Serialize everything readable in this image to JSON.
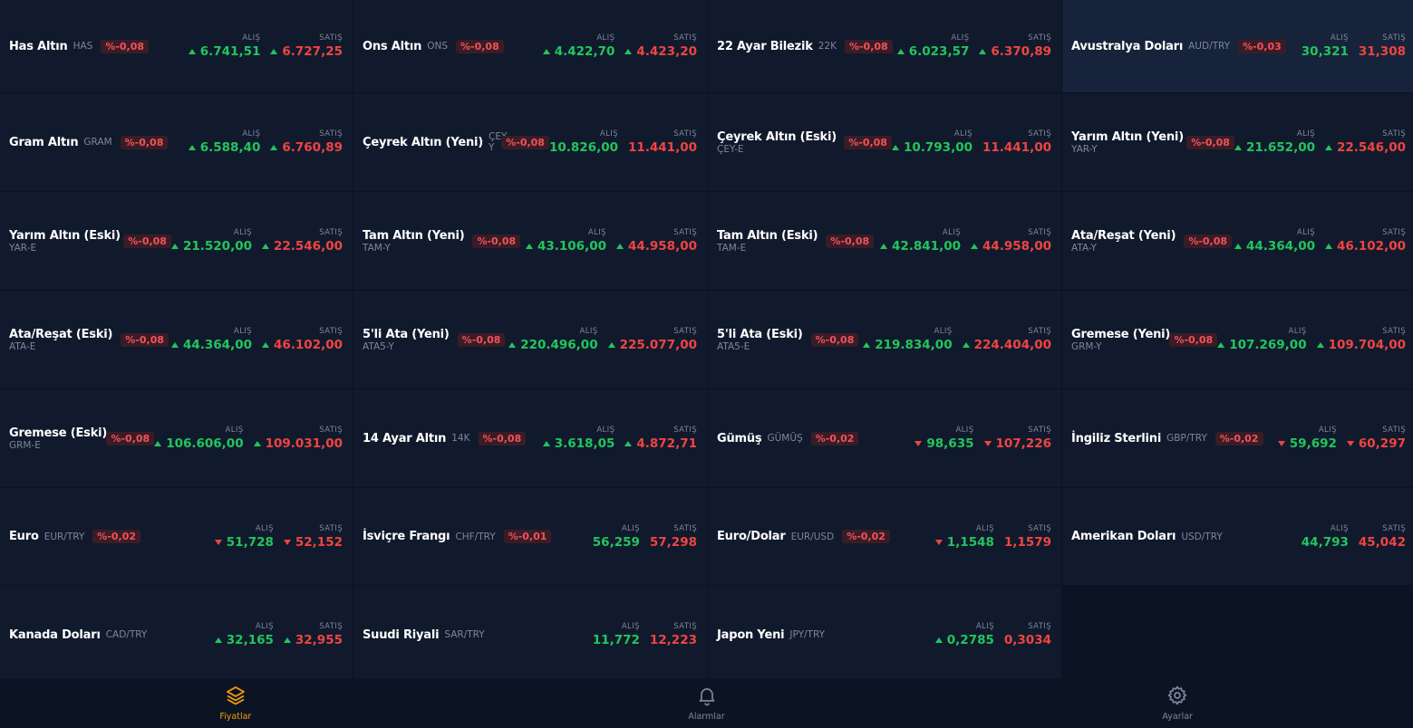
{
  "labels": {
    "buy": "ALIŞ",
    "sell": "SATIŞ"
  },
  "colors": {
    "up": "#22c55e",
    "down": "#ef4444",
    "accent": "#f59e0b",
    "background": "#111a2c"
  },
  "rows": [
    [
      {
        "name": "Has Altın",
        "code": "HAS",
        "badge": "%-0,08",
        "buy": "6.741,51",
        "sell": "6.727,25",
        "buy_arrow": "up",
        "sell_arrow": "up",
        "layout": "inline"
      },
      {
        "name": "Ons Altın",
        "code": "ONS",
        "badge": "%-0,08",
        "buy": "4.422,70",
        "sell": "4.423,20",
        "buy_arrow": "up",
        "sell_arrow": "up",
        "layout": "inline"
      },
      {
        "name": "22 Ayar Bilezik",
        "code": "22K",
        "badge": "%-0,08",
        "buy": "6.023,57",
        "sell": "6.370,89",
        "buy_arrow": "up",
        "sell_arrow": "up",
        "layout": "inline"
      },
      {
        "name": "Avustralya Doları",
        "code": "AUD/TRY",
        "badge": "%-0,03",
        "buy": "30,321",
        "sell": "31,308",
        "buy_arrow": "none",
        "sell_arrow": "none",
        "layout": "inline",
        "highlight": true
      }
    ],
    [
      {
        "name": "Gram Altın",
        "code": "GRAM",
        "badge": "%-0,08",
        "buy": "6.588,40",
        "sell": "6.760,89",
        "buy_arrow": "up",
        "sell_arrow": "up",
        "layout": "inline"
      },
      {
        "name": "Çeyrek Altın (Yeni)",
        "code": "ÇEY-Y",
        "badge": "%-0,08",
        "buy": "10.826,00",
        "sell": "11.441,00",
        "buy_arrow": "none",
        "sell_arrow": "none",
        "layout": "wrap"
      },
      {
        "name": "Çeyrek Altın (Eski)",
        "code": "ÇEY-E",
        "badge": "%-0,08",
        "buy": "10.793,00",
        "sell": "11.441,00",
        "buy_arrow": "up",
        "sell_arrow": "none",
        "layout": "stack"
      },
      {
        "name": "Yarım Altın (Yeni)",
        "code": "YAR-Y",
        "badge": "%-0,08",
        "buy": "21.652,00",
        "sell": "22.546,00",
        "buy_arrow": "up",
        "sell_arrow": "up",
        "layout": "stack"
      }
    ],
    [
      {
        "name": "Yarım Altın (Eski)",
        "code": "YAR-E",
        "badge": "%-0,08",
        "buy": "21.520,00",
        "sell": "22.546,00",
        "buy_arrow": "up",
        "sell_arrow": "up",
        "layout": "stack"
      },
      {
        "name": "Tam Altın (Yeni)",
        "code": "TAM-Y",
        "badge": "%-0,08",
        "buy": "43.106,00",
        "sell": "44.958,00",
        "buy_arrow": "up",
        "sell_arrow": "up",
        "layout": "stack"
      },
      {
        "name": "Tam Altın (Eski)",
        "code": "TAM-E",
        "badge": "%-0,08",
        "buy": "42.841,00",
        "sell": "44.958,00",
        "buy_arrow": "up",
        "sell_arrow": "up",
        "layout": "stack"
      },
      {
        "name": "Ata/Reşat (Yeni)",
        "code": "ATA-Y",
        "badge": "%-0,08",
        "buy": "44.364,00",
        "sell": "46.102,00",
        "buy_arrow": "up",
        "sell_arrow": "up",
        "layout": "stack"
      }
    ],
    [
      {
        "name": "Ata/Reşat (Eski)",
        "code": "ATA-E",
        "badge": "%-0,08",
        "buy": "44.364,00",
        "sell": "46.102,00",
        "buy_arrow": "up",
        "sell_arrow": "up",
        "layout": "stack"
      },
      {
        "name": "5'li Ata (Yeni)",
        "code": "ATA5-Y",
        "badge": "%-0,08",
        "buy": "220.496,00",
        "sell": "225.077,00",
        "buy_arrow": "up",
        "sell_arrow": "up",
        "layout": "stack"
      },
      {
        "name": "5'li Ata (Eski)",
        "code": "ATA5-E",
        "badge": "%-0,08",
        "buy": "219.834,00",
        "sell": "224.404,00",
        "buy_arrow": "up",
        "sell_arrow": "up",
        "layout": "stack"
      },
      {
        "name": "Gremese (Yeni)",
        "code": "GRM-Y",
        "badge": "%-0,08",
        "buy": "107.269,00",
        "sell": "109.704,00",
        "buy_arrow": "up",
        "sell_arrow": "up",
        "layout": "stack"
      }
    ],
    [
      {
        "name": "Gremese (Eski)",
        "code": "GRM-E",
        "badge": "%-0,08",
        "buy": "106.606,00",
        "sell": "109.031,00",
        "buy_arrow": "up",
        "sell_arrow": "up",
        "layout": "stack"
      },
      {
        "name": "14 Ayar Altın",
        "code": "14K",
        "badge": "%-0,08",
        "buy": "3.618,05",
        "sell": "4.872,71",
        "buy_arrow": "up",
        "sell_arrow": "up",
        "layout": "inline"
      },
      {
        "name": "Gümüş",
        "code": "GÜMÜŞ",
        "badge": "%-0,02",
        "buy": "98,635",
        "sell": "107,226",
        "buy_arrow": "down",
        "sell_arrow": "down",
        "layout": "inline"
      },
      {
        "name": "İngiliz Sterlini",
        "code": "GBP/TRY",
        "badge": "%-0,02",
        "buy": "59,692",
        "sell": "60,297",
        "buy_arrow": "down",
        "sell_arrow": "down",
        "layout": "inline"
      }
    ],
    [
      {
        "name": "Euro",
        "code": "EUR/TRY",
        "badge": "%-0,02",
        "buy": "51,728",
        "sell": "52,152",
        "buy_arrow": "down",
        "sell_arrow": "down",
        "layout": "inline"
      },
      {
        "name": "İsviçre Frangı",
        "code": "CHF/TRY",
        "badge": "%-0,01",
        "buy": "56,259",
        "sell": "57,298",
        "buy_arrow": "none",
        "sell_arrow": "none",
        "layout": "inline"
      },
      {
        "name": "Euro/Dolar",
        "code": "EUR/USD",
        "badge": "%-0,02",
        "buy": "1,1548",
        "sell": "1,1579",
        "buy_arrow": "down",
        "sell_arrow": "none",
        "layout": "inline"
      },
      {
        "name": "Amerikan Doları",
        "code": "USD/TRY",
        "badge": "",
        "buy": "44,793",
        "sell": "45,042",
        "buy_arrow": "none",
        "sell_arrow": "none",
        "layout": "inline"
      }
    ],
    [
      {
        "name": "Kanada Doları",
        "code": "CAD/TRY",
        "badge": "",
        "buy": "32,165",
        "sell": "32,955",
        "buy_arrow": "up",
        "sell_arrow": "up",
        "layout": "inline"
      },
      {
        "name": "Suudi Riyali",
        "code": "SAR/TRY",
        "badge": "",
        "buy": "11,772",
        "sell": "12,223",
        "buy_arrow": "none",
        "sell_arrow": "none",
        "layout": "inline"
      },
      {
        "name": "Japon Yeni",
        "code": "JPY/TRY",
        "badge": "",
        "buy": "0,2785",
        "sell": "0,3034",
        "buy_arrow": "up",
        "sell_arrow": "none",
        "layout": "inline"
      },
      null
    ]
  ],
  "nav": [
    {
      "label": "Fiyatlar",
      "icon": "layers-icon",
      "active": true
    },
    {
      "label": "Alarmlar",
      "icon": "bell-icon",
      "active": false
    },
    {
      "label": "Ayarlar",
      "icon": "gear-icon",
      "active": false
    }
  ]
}
